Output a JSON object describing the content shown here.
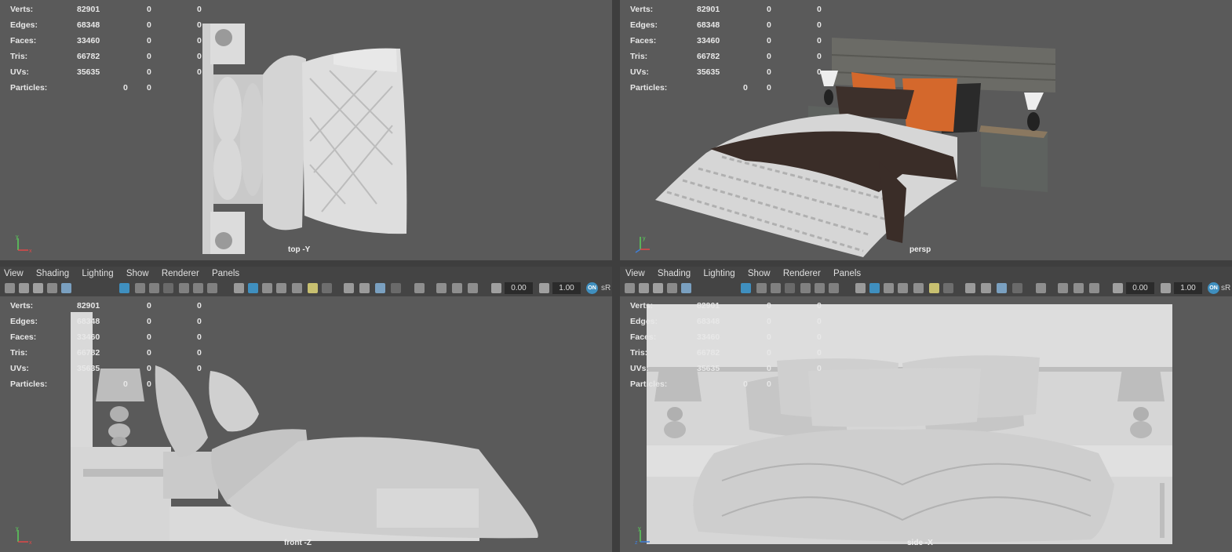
{
  "hud_stats": [
    {
      "label": "Verts:",
      "a": "82901",
      "b": "0",
      "c": "0"
    },
    {
      "label": "Edges:",
      "a": "68348",
      "b": "0",
      "c": "0"
    },
    {
      "label": "Faces:",
      "a": "33460",
      "b": "0",
      "c": "0"
    },
    {
      "label": "Tris:",
      "a": "66782",
      "b": "0",
      "c": "0"
    },
    {
      "label": "UVs:",
      "a": "35635",
      "b": "0",
      "c": "0"
    },
    {
      "label": "Particles:",
      "a": "0",
      "b": "0"
    }
  ],
  "viewports": {
    "top": {
      "camera": "top -Y"
    },
    "persp": {
      "camera": "persp"
    },
    "front": {
      "camera": "front -Z"
    },
    "side": {
      "camera": "side -X"
    }
  },
  "panel_menu": [
    "View",
    "Shading",
    "Lighting",
    "Show",
    "Renderer",
    "Panels"
  ],
  "toolbar": {
    "near_value": "0.00",
    "far_value": "1.00",
    "badge": "ON",
    "color_space": "sR"
  },
  "colors": {
    "viewport_bg": "#5a5a5a",
    "ui_bg": "#444444",
    "accent": "#3f8fbf",
    "orange": "#d4682c"
  }
}
